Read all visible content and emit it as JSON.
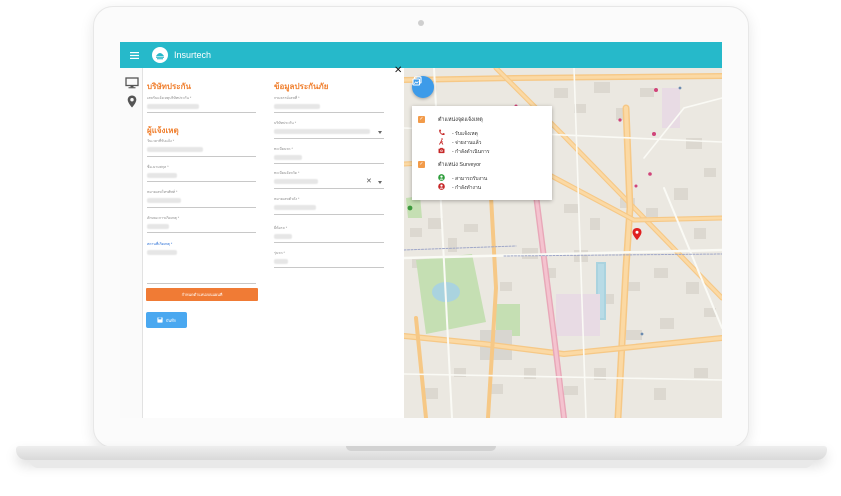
{
  "app": {
    "brand": "Insurtech"
  },
  "sidebar": {
    "items": [
      {
        "icon": "monitor-icon"
      },
      {
        "icon": "map-pin-icon"
      }
    ]
  },
  "form": {
    "company_section": {
      "title": "บริษัทประกัน",
      "fields": [
        {
          "label": "เลขรับแจ้งเหตุบริษัทประกัน *"
        }
      ]
    },
    "reporter_section": {
      "title": "ผู้แจ้งเหตุ",
      "fields": [
        {
          "label": "วันเวลาที่รับแจ้ง *"
        },
        {
          "label": "ชื่อ-นามสกุล *"
        },
        {
          "label": "หมายเลขโทรศัพท์ *"
        },
        {
          "label": "ลักษณะการเกิดเหตุ *"
        },
        {
          "label": "สถานที่เกิดเหตุ *"
        }
      ]
    },
    "insurance_section": {
      "title": "ข้อมูลประกันภัย",
      "fields": [
        {
          "label": "กรมธรรม์เลขที่ *"
        },
        {
          "label": "บริษัทประกัน *"
        },
        {
          "label": "ทะเบียนรถ *"
        },
        {
          "label": "ทะเบียนจังหวัด *"
        },
        {
          "label": "หมายเลขตัวถัง *"
        },
        {
          "label": "ยี่ห้อรถ *"
        },
        {
          "label": "รุ่นรถ *"
        }
      ]
    },
    "location_button": "กำหนดตำแหน่งบนแผนที่",
    "save_button": "บันทึก"
  },
  "map": {
    "legend": {
      "incident_group": {
        "title": "ตำแหน่งจุดแจ้งเหตุ",
        "items": [
          {
            "label": "- รับแจ้งเหตุ",
            "icon": "phone-icon",
            "color": "#c62828"
          },
          {
            "label": "- จ่ายงานแล้ว",
            "icon": "walker-icon",
            "color": "#c62828"
          },
          {
            "label": "- กำลังดำเนินการ",
            "icon": "camera-icon",
            "color": "#c62828"
          }
        ]
      },
      "surveyor_group": {
        "title": "ตำแหน่ง Surveyor",
        "items": [
          {
            "label": "- สามารถรับงาน",
            "icon": "user-icon",
            "color": "#2e9e3c"
          },
          {
            "label": "- กำลังทำงาน",
            "icon": "user-icon",
            "color": "#c62828"
          }
        ]
      }
    }
  },
  "colors": {
    "topbar": "#26b9ca",
    "section_title": "#f08030",
    "location_button": "#f07b35",
    "save_button": "#4aa8f0",
    "legend_check": "#f29b4a",
    "map_marker": "#e02020"
  }
}
